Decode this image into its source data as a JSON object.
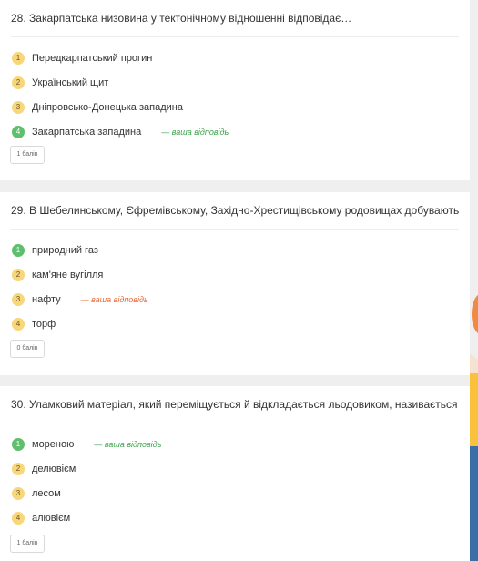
{
  "questions": [
    {
      "title": "28. Закарпатська низовина у тектонічному відношенні відповідає…",
      "answers": [
        {
          "n": "1",
          "text": "Передкарпатський прогин"
        },
        {
          "n": "2",
          "text": "Український щит"
        },
        {
          "n": "3",
          "text": "Дніпровсько-Донецька западина"
        },
        {
          "n": "4",
          "text": "Закарпатська западина",
          "mark": "— ваша відповідь"
        }
      ],
      "score": "1 балів"
    },
    {
      "title": "29. В Шебелинському, Єфремівському, Західно-Хрестищівському родовищах добувають…",
      "answers": [
        {
          "n": "1",
          "text": "природний газ"
        },
        {
          "n": "2",
          "text": "кам'яне вугілля"
        },
        {
          "n": "3",
          "text": "нафту",
          "mark": "— ваша відповідь"
        },
        {
          "n": "4",
          "text": "торф"
        }
      ],
      "score": "0 балів"
    },
    {
      "title": "30. Уламковий матеріал, який переміщується й відкладається льодовиком, називається…",
      "answers": [
        {
          "n": "1",
          "text": "мореною",
          "mark": "— ваша відповідь"
        },
        {
          "n": "2",
          "text": "делювієм"
        },
        {
          "n": "3",
          "text": "лесом"
        },
        {
          "n": "4",
          "text": "алювієм"
        }
      ],
      "score": "1 балів"
    }
  ],
  "colors": {
    "correct": "#5fbf6e",
    "option": "#f8d77a",
    "correct_mark": "#3fa34d",
    "wrong_mark": "#ec6a3a"
  }
}
